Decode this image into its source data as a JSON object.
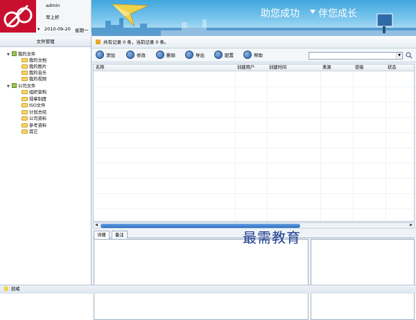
{
  "header": {
    "username": "admin",
    "greeting": "早上好",
    "date": "2010-09-20",
    "weekday": "星期一",
    "slogan_left": "助您成功",
    "slogan_right": "伴您成长",
    "brand_color": "#c8102e"
  },
  "sidebar": {
    "title": "文件管理",
    "tree": [
      {
        "label": "我的文件",
        "children": [
          "我的文档",
          "我的图片",
          "我的音乐",
          "我的视频"
        ]
      },
      {
        "label": "公司文件",
        "children": [
          "组织架构",
          "规章制度",
          "ISO文件",
          "计划总结",
          "公司资料",
          "参考资料",
          "其它"
        ]
      }
    ]
  },
  "info_bar": {
    "text": "共有记录 0 条，当前记录 0 条。"
  },
  "toolbar": {
    "add": "添加",
    "edit": "修改",
    "delete": "删除",
    "export": "导出",
    "config": "配置",
    "help": "帮助"
  },
  "search": {
    "value": ""
  },
  "table": {
    "columns": [
      "名称",
      "创建用户",
      "创建时间",
      "来源",
      "密级",
      "状态"
    ],
    "rows": []
  },
  "detail_tabs": [
    "详细",
    "备注"
  ],
  "watermark": "最需教育",
  "status": {
    "text": "就绪"
  }
}
